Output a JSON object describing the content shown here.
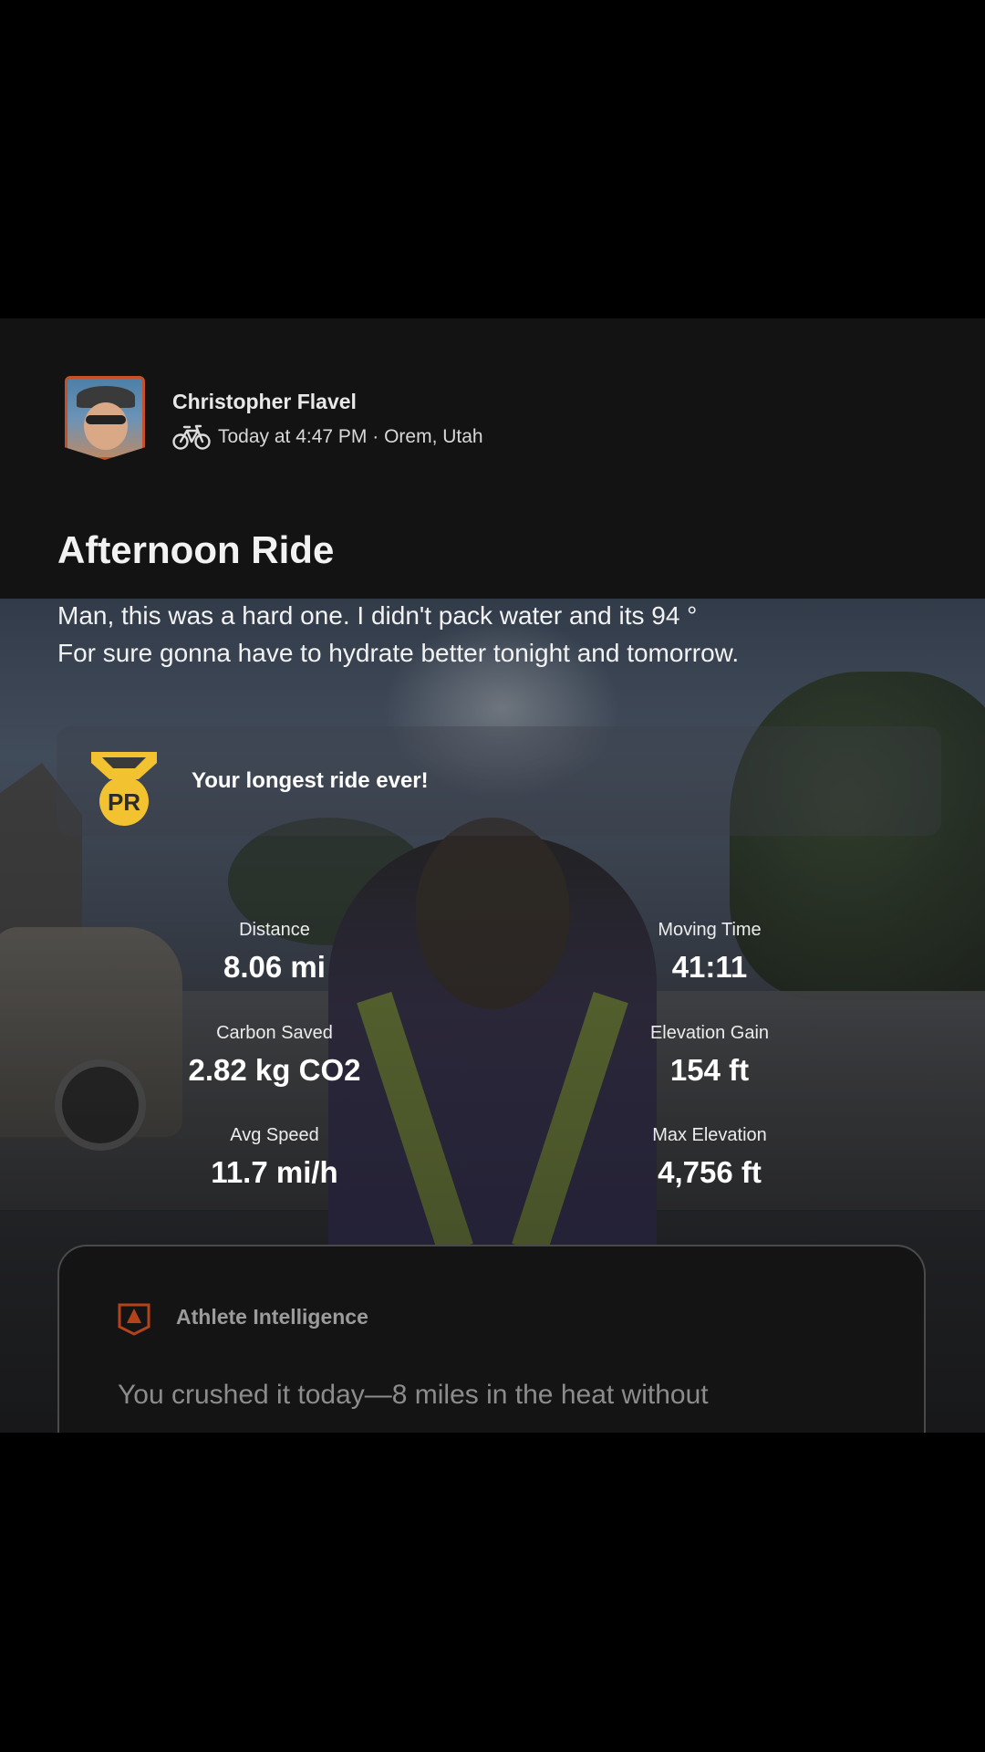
{
  "post": {
    "athlete_name": "Christopher Flavel",
    "activity_icon": "bike-icon",
    "meta": "Today at 4:47 PM · Orem, Utah",
    "title": "Afternoon Ride",
    "description_line_1": "Man, this was a hard one. I didn't pack water and its 94 °",
    "description_line_2": "For sure gonna have to hydrate better tonight and tomorrow."
  },
  "achievement": {
    "badge_text": "PR",
    "text": "Your longest ride ever!",
    "badge_color": "#f2c230"
  },
  "stats": [
    {
      "label": "Distance",
      "value": "8.06 mi"
    },
    {
      "label": "Moving Time",
      "value": "41:11"
    },
    {
      "label": "Carbon Saved",
      "value": "2.82 kg CO2"
    },
    {
      "label": "Elevation Gain",
      "value": "154 ft"
    },
    {
      "label": "Avg Speed",
      "value": "11.7 mi/h"
    },
    {
      "label": "Max Elevation",
      "value": "4,756 ft"
    }
  ],
  "athlete_intelligence": {
    "title": "Athlete Intelligence",
    "summary": "You crushed it today—8 miles in the heat without"
  },
  "nav": {
    "recents_icon": "recents-icon",
    "home_icon": "home-icon",
    "back_icon": "back-icon"
  },
  "colors": {
    "background": "#131313",
    "accent": "#fc5200"
  }
}
